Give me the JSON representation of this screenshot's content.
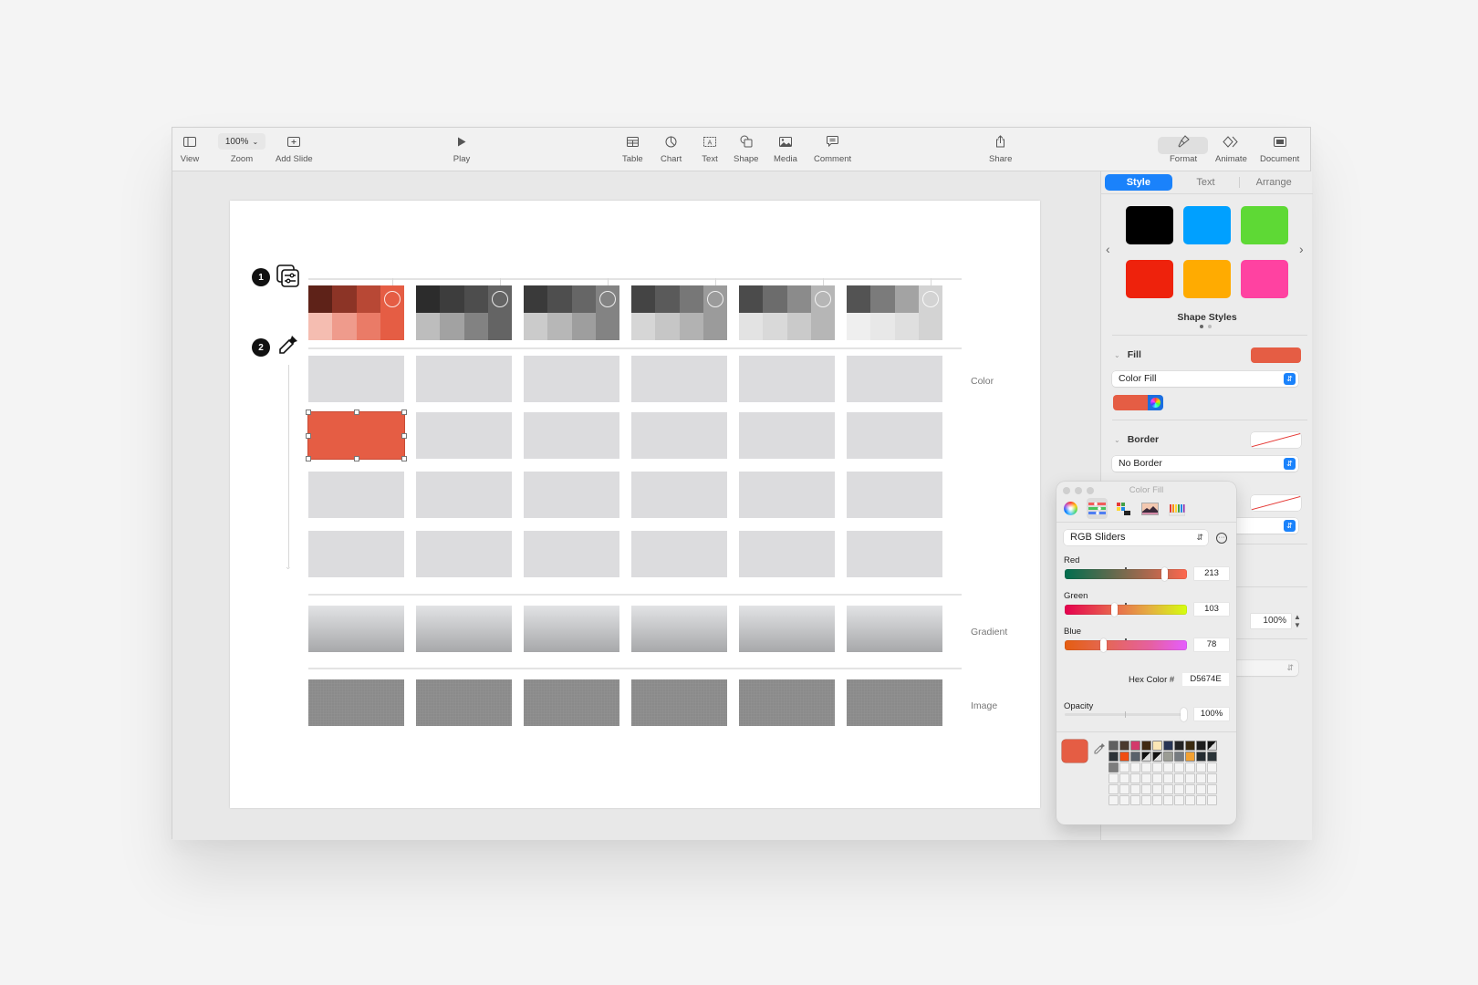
{
  "toolbar": {
    "view": "View",
    "zoom_value": "100%",
    "zoom": "Zoom",
    "add_slide": "Add Slide",
    "play": "Play",
    "table": "Table",
    "chart": "Chart",
    "text": "Text",
    "shape": "Shape",
    "media": "Media",
    "comment": "Comment",
    "share": "Share",
    "format": "Format",
    "animate": "Animate",
    "document": "Document"
  },
  "slide": {
    "steps": [
      "1",
      "2"
    ],
    "row_labels": {
      "color": "Color",
      "gradient": "Gradient",
      "image": "Image"
    },
    "selected_fill": "#E55D44",
    "swatch_groups": [
      {
        "dark": [
          "#5e2218",
          "#8c3426",
          "#b84835"
        ],
        "light": [
          "#f5bdb1",
          "#ef9b8c",
          "#ea7b67"
        ],
        "base": "#e55d44"
      },
      {
        "dark": [
          "#2c2c2c",
          "#3d3d3d",
          "#4d4d4d"
        ],
        "light": [
          "#bdbdbd",
          "#a2a2a2",
          "#828282"
        ],
        "base": "#646464"
      },
      {
        "dark": [
          "#3a3a3a",
          "#4e4e4e",
          "#666666"
        ],
        "light": [
          "#cbcbcb",
          "#b7b7b7",
          "#9e9e9e"
        ],
        "base": "#838383"
      },
      {
        "dark": [
          "#444444",
          "#5a5a5a",
          "#777777"
        ],
        "light": [
          "#d6d6d6",
          "#c6c6c6",
          "#b2b2b2"
        ],
        "base": "#9b9b9b"
      },
      {
        "dark": [
          "#4b4b4b",
          "#6c6c6c",
          "#8b8b8b"
        ],
        "light": [
          "#e3e3e3",
          "#d9d9d9",
          "#cacaca"
        ],
        "base": "#b6b6b6"
      },
      {
        "dark": [
          "#535353",
          "#7b7b7b",
          "#a3a3a3"
        ],
        "light": [
          "#efefef",
          "#e8e8e8",
          "#dfdfdf"
        ],
        "base": "#d3d3d3"
      }
    ]
  },
  "inspector": {
    "tabs": [
      "Style",
      "Text",
      "Arrange"
    ],
    "active_tab": "Style",
    "shape_styles": [
      "#000000",
      "#00a0ff",
      "#5ed935",
      "#ee220c",
      "#ffab01",
      "#ff42a1"
    ],
    "shape_styles_label": "Shape Styles",
    "fill_label": "Fill",
    "fill_color": "#E55D44",
    "fill_type": "Color Fill",
    "border_label": "Border",
    "border_type": "No Border",
    "opacity_value": "100%"
  },
  "color_panel": {
    "title": "Color Fill",
    "mode": "RGB Sliders",
    "channels": [
      {
        "label": "Red",
        "value": "213"
      },
      {
        "label": "Green",
        "value": "103"
      },
      {
        "label": "Blue",
        "value": "78"
      }
    ],
    "hex_label": "Hex Color #",
    "hex_value": "D5674E",
    "opacity_label": "Opacity",
    "opacity_value": "100%",
    "current_color": "#E55D44",
    "saved_swatches": [
      "#606060",
      "#4a3a2e",
      "#d23a6b",
      "#3f2a12",
      "#fbe7b6",
      "#283553",
      "#232323",
      "#3a2a10",
      "#1e1e1e",
      "diag",
      "#2e3438",
      "#f04d12",
      "#59616a",
      "diag",
      "diag",
      "#9b9c94",
      "#767b80",
      "#f3a132",
      "#252c31",
      "#2b3438",
      "#7c7c7c"
    ]
  }
}
